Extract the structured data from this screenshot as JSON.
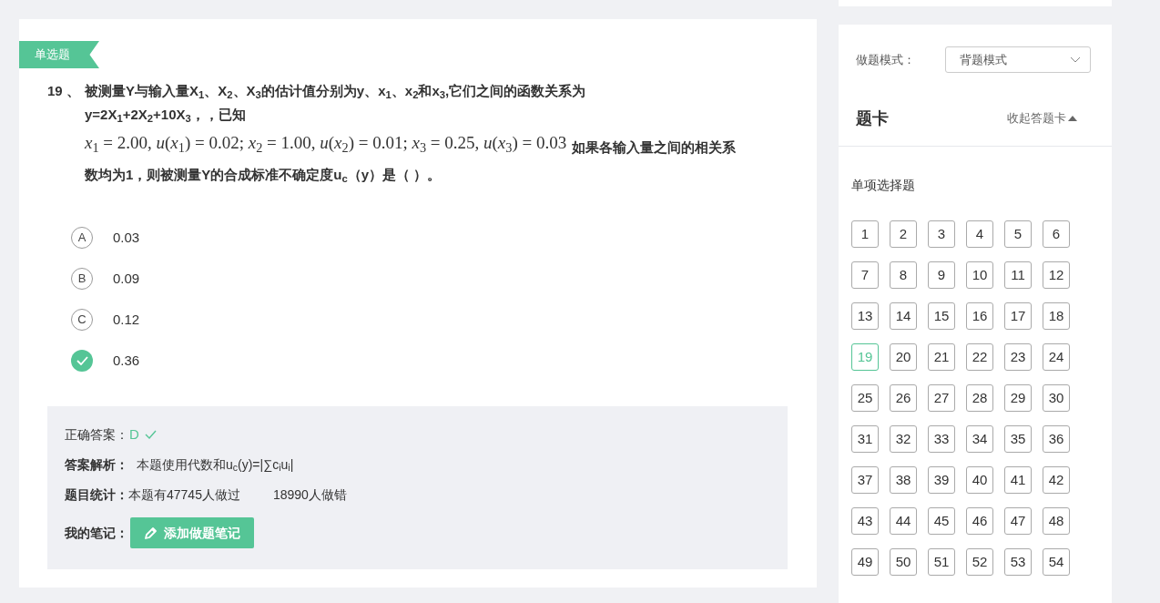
{
  "question": {
    "type_tag": "单选题",
    "number": "19 、",
    "text_line_1": "被测量Y与输入量X$_{1}$、X$_{2}$、X$_{3}$的估计值分别为y、x$_{1}$、x$_{2}$和x$_{3}$,它们之间的函数关系为",
    "text_line_2": "y=2X$_{1}$+2X$_{2}$+10X$_{3}$，，已知",
    "formula": "*x*$_{1}$ = 2.00, *u*(*x*$_{1}$) = 0.02; *x*$_{2}$ = 1.00, *u*(*x*$_{2}$) = 0.01; *x*$_{3}$ = 0.25, *u*(*x*$_{3}$) = 0.03",
    "text_after_formula": "如果各输入量之间的相关系",
    "text_line_4": "数均为1，则被测量Y的合成标准不确定度u$_{c}$（y）是（ ）。"
  },
  "options": [
    {
      "letter": "A",
      "text": "0.03",
      "selected": false
    },
    {
      "letter": "B",
      "text": "0.09",
      "selected": false
    },
    {
      "letter": "C",
      "text": "0.12",
      "selected": false
    },
    {
      "text": "0.36",
      "selected": true
    }
  ],
  "analysis": {
    "correct_label": "正确答案：",
    "correct_value": "D",
    "explain_label": "答案解析：",
    "explain_text": "本题使用代数和u$_{c}$(y)=|∑c$_{i}$u$_{i}$|",
    "stats_label": "题目统计：",
    "stats_done": "本题有47745人做过",
    "stats_wrong": "18990人做错",
    "notes_label": "我的笔记：",
    "notes_button": "添加做题笔记"
  },
  "sidebar": {
    "mode_label": "做题模式：",
    "mode_value": "背题模式",
    "card_title": "题卡",
    "collapse_link": "收起答题卡",
    "section_title": "单项选择题",
    "numbers": [
      {
        "n": "1",
        "selected": false
      },
      {
        "n": "2",
        "selected": false
      },
      {
        "n": "3",
        "selected": false
      },
      {
        "n": "4",
        "selected": false
      },
      {
        "n": "5",
        "selected": false
      },
      {
        "n": "6",
        "selected": false
      },
      {
        "n": "7",
        "selected": false
      },
      {
        "n": "8",
        "selected": false
      },
      {
        "n": "9",
        "selected": false
      },
      {
        "n": "10",
        "selected": false
      },
      {
        "n": "11",
        "selected": false
      },
      {
        "n": "12",
        "selected": false
      },
      {
        "n": "13",
        "selected": false
      },
      {
        "n": "14",
        "selected": false
      },
      {
        "n": "15",
        "selected": false
      },
      {
        "n": "16",
        "selected": false
      },
      {
        "n": "17",
        "selected": false
      },
      {
        "n": "18",
        "selected": false
      },
      {
        "n": "19",
        "selected": true
      },
      {
        "n": "20",
        "selected": false
      },
      {
        "n": "21",
        "selected": false
      },
      {
        "n": "22",
        "selected": false
      },
      {
        "n": "23",
        "selected": false
      },
      {
        "n": "24",
        "selected": false
      },
      {
        "n": "25",
        "selected": false
      },
      {
        "n": "26",
        "selected": false
      },
      {
        "n": "27",
        "selected": false
      },
      {
        "n": "28",
        "selected": false
      },
      {
        "n": "29",
        "selected": false
      },
      {
        "n": "30",
        "selected": false
      },
      {
        "n": "31",
        "selected": false
      },
      {
        "n": "32",
        "selected": false
      },
      {
        "n": "33",
        "selected": false
      },
      {
        "n": "34",
        "selected": false
      },
      {
        "n": "35",
        "selected": false
      },
      {
        "n": "36",
        "selected": false
      },
      {
        "n": "37",
        "selected": false
      },
      {
        "n": "38",
        "selected": false
      },
      {
        "n": "39",
        "selected": false
      },
      {
        "n": "40",
        "selected": false
      },
      {
        "n": "41",
        "selected": false
      },
      {
        "n": "42",
        "selected": false
      },
      {
        "n": "43",
        "selected": false
      },
      {
        "n": "44",
        "selected": false
      },
      {
        "n": "45",
        "selected": false
      },
      {
        "n": "46",
        "selected": false
      },
      {
        "n": "47",
        "selected": false
      },
      {
        "n": "48",
        "selected": false
      },
      {
        "n": "49",
        "selected": false
      },
      {
        "n": "50",
        "selected": false
      },
      {
        "n": "51",
        "selected": false
      },
      {
        "n": "52",
        "selected": false
      },
      {
        "n": "53",
        "selected": false
      },
      {
        "n": "54",
        "selected": false
      }
    ]
  }
}
